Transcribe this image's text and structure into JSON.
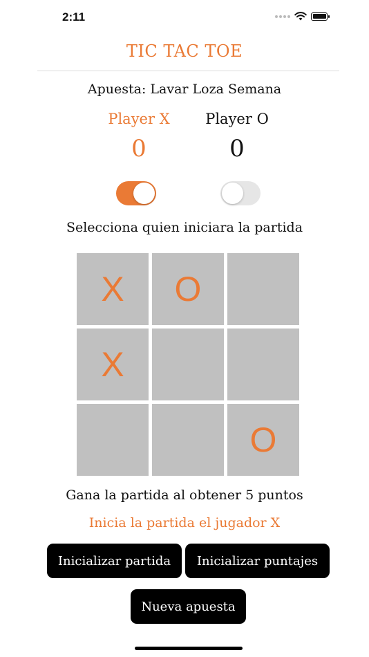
{
  "status_bar": {
    "time": "2:11"
  },
  "header": {
    "title": "TIC TAC TOE"
  },
  "bet": {
    "label": "Apuesta: Lavar Loza Semana"
  },
  "players": {
    "x": {
      "label": "Player X",
      "score": "0",
      "starts": true
    },
    "o": {
      "label": "Player O",
      "score": "0",
      "starts": false
    }
  },
  "select_prompt": "Selecciona quien iniciara la partida",
  "board": {
    "cells": [
      "X",
      "O",
      "",
      "X",
      "",
      "",
      "",
      "",
      "O"
    ]
  },
  "win_rule": "Gana la partida al obtener 5 puntos",
  "start_info": "Inicia la partida el jugador X",
  "buttons": {
    "reset_game": "Inicializar partida",
    "reset_scores": "Inicializar puntajes",
    "new_bet": "Nueva apuesta"
  },
  "colors": {
    "accent": "#ea7a35",
    "cell_bg": "#c0c0c0",
    "button_bg": "#000000"
  }
}
